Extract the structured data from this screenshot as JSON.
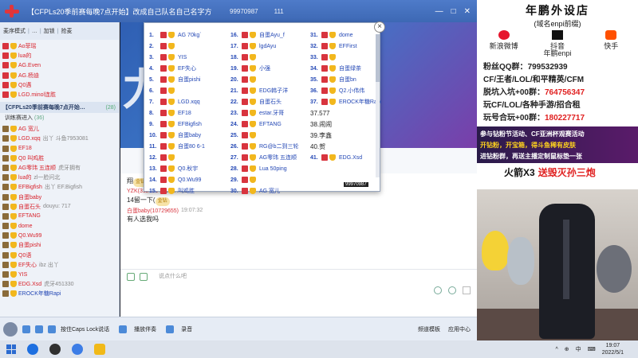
{
  "titlebar": {
    "title": "【CFPLs20季前赛每晚7点开始】改成自己队名自己名字方便…",
    "room_id": "99970987",
    "count": "111",
    "controls": [
      "—",
      "□",
      "✕"
    ]
  },
  "sidebar": {
    "tabs": [
      "麦序模式",
      "…",
      "加锁",
      "抢麦"
    ],
    "mic_list": [
      {
        "mark": "u",
        "name": "Ao菲瑶",
        "c": "red"
      },
      {
        "mark": "u",
        "name": "lua的",
        "c": "red"
      },
      {
        "mark": "u",
        "name": "AG.Even",
        "c": "red"
      },
      {
        "mark": "u",
        "name": "AG.杨迪",
        "c": "red"
      },
      {
        "mark": "u",
        "name": "Q0遇",
        "c": "red"
      },
      {
        "mark": "u",
        "name": "LGD.minol连胜",
        "c": "red"
      }
    ],
    "channel": {
      "name": "【CFPLs20季前赛每晚7点开始…",
      "count": "(28)"
    },
    "sub_channel": {
      "name": "训练赛进入",
      "count": "(36)"
    },
    "users": [
      {
        "name": "AG 宽儿",
        "c": "red",
        "extra": ""
      },
      {
        "name": "LGD.xqq",
        "c": "red",
        "extra": "出丫 斗鱼7953081"
      },
      {
        "name": "EF18",
        "c": "red",
        "extra": ""
      },
      {
        "name": "Q0 叫鸡胜",
        "c": "red",
        "extra": ""
      },
      {
        "name": "AG零玮 五连顺",
        "c": "red",
        "extra": "虎牙拥有"
      },
      {
        "name": "lua的",
        "c": "red",
        "extra": "zl一脸问北"
      },
      {
        "name": "EFBigfish",
        "c": "red",
        "extra": "出丫 EF.Bigfish"
      },
      {
        "name": "自蛋baby",
        "c": "red",
        "extra": ""
      },
      {
        "name": "自蛋石头",
        "c": "red",
        "extra": "douyu: 717"
      },
      {
        "name": "EFTANG",
        "c": "red",
        "extra": ""
      },
      {
        "name": "dome",
        "c": "red",
        "extra": ""
      },
      {
        "name": "Q0.Wu99",
        "c": "red",
        "extra": ""
      },
      {
        "name": "自蛋pishi",
        "c": "red",
        "extra": ""
      },
      {
        "name": "Q0语",
        "c": "red",
        "extra": ""
      },
      {
        "name": "EF失心",
        "c": "red",
        "extra": "ibz 出丫"
      },
      {
        "name": "YIS",
        "c": "red",
        "extra": ""
      },
      {
        "name": "EDG.Xsd",
        "c": "red",
        "extra": "虎牙451330"
      },
      {
        "name": "EROCK年糖Rapi",
        "c": "blue",
        "extra": ""
      }
    ]
  },
  "main": {
    "banner_text": "力",
    "chat": [
      {
        "meta": "",
        "who": "",
        "time": "",
        "body": "翔",
        "badge": "金钻"
      },
      {
        "meta": "YZK(3127864)",
        "who": "",
        "time": "19:07:31",
        "body": "14留一下(",
        "badge": "金钻"
      },
      {
        "meta": "白蛋baby(10729655)",
        "who": "",
        "time": "19:07:32",
        "body": "有人选我吗",
        "badge": ""
      }
    ],
    "input_placeholder": "说点什么吧"
  },
  "appbar": {
    "items": [
      "按住Caps Lock说话",
      "播放伴奏",
      "录音"
    ],
    "right": [
      "频道模板",
      "应用中心"
    ]
  },
  "popup": {
    "col1": [
      {
        "n": "1.",
        "name": "AG 70kg`"
      },
      {
        "n": "2.",
        "name": ""
      },
      {
        "n": "3.",
        "name": "YIS"
      },
      {
        "n": "4.",
        "name": "EF失心"
      },
      {
        "n": "5.",
        "name": "自蛋pishi"
      },
      {
        "n": "6.",
        "name": ""
      },
      {
        "n": "7.",
        "name": "LGD.xqq"
      },
      {
        "n": "8.",
        "name": "EF18"
      },
      {
        "n": "9.",
        "name": "EFBigfish"
      },
      {
        "n": "10.",
        "name": "自蛋baby"
      },
      {
        "n": "11.",
        "name": "自蛋80 6-1"
      },
      {
        "n": "12.",
        "name": ""
      },
      {
        "n": "13.",
        "name": "Q0.秋宇"
      },
      {
        "n": "14.",
        "name": "Q0.Wu99"
      },
      {
        "n": "15.",
        "name": "叫鸡胜"
      }
    ],
    "col2": [
      {
        "n": "16.",
        "name": "自蛋Ayu_f"
      },
      {
        "n": "17.",
        "name": "lgdAyu"
      },
      {
        "n": "18.",
        "name": ""
      },
      {
        "n": "19.",
        "name": "小强"
      },
      {
        "n": "20.",
        "name": ""
      },
      {
        "n": "21.",
        "name": "EDG韩子洋"
      },
      {
        "n": "22.",
        "name": "自蛋石头"
      },
      {
        "n": "23.",
        "name": "estar.牙哥"
      },
      {
        "n": "24.",
        "name": "EFTANG"
      },
      {
        "n": "25.",
        "name": ""
      },
      {
        "n": "26.",
        "name": "RG@b二到三轮"
      },
      {
        "n": "27.",
        "name": "AG零玮 五连顺"
      },
      {
        "n": "28.",
        "name": "Lua 50ping"
      },
      {
        "n": "29.",
        "name": ""
      },
      {
        "n": "30.",
        "name": "AG 宽儿"
      }
    ],
    "col3": [
      {
        "n": "31.",
        "name": "dome"
      },
      {
        "n": "32.",
        "name": "EFFirst"
      },
      {
        "n": "33.",
        "name": ""
      },
      {
        "n": "34.",
        "name": "自蛋绿茶"
      },
      {
        "n": "35.",
        "name": "自蛋bn"
      },
      {
        "n": "36.",
        "name": "Q2.小伟伟"
      },
      {
        "n": "37.",
        "name": "EROCK年糖Rapi"
      }
    ],
    "plain": [
      {
        "n": "37.",
        "name": "577"
      },
      {
        "n": "38.",
        "name": "闹闹"
      },
      {
        "n": "39.",
        "name": "李鑫"
      },
      {
        "n": "40.",
        "name": "贺"
      }
    ],
    "last": {
      "n": "41.",
      "name": "EDG.Xsd"
    },
    "footer": "99970987"
  },
  "stream": {
    "title": "年鹏外设店",
    "subtitle": "(域名enpi前缀)",
    "socials": [
      "新浪微博",
      "抖音",
      "快手"
    ],
    "logo": "年鹏enpi",
    "info": [
      {
        "label": "粉丝QQ群：",
        "value": "799532939",
        "red": false
      },
      {
        "label": "CF/王者/LOL/和平精英/CFM",
        "value": "",
        "red": false
      },
      {
        "label": "脱坑入坑+00群：",
        "value": "764756347",
        "red": true
      },
      {
        "label": "玩CF/LOL/各种手游/招合租",
        "value": "",
        "red": false
      },
      {
        "label": "玩号合玩+00群：",
        "value": "180227717",
        "red": true
      }
    ],
    "event": [
      "参与钻粉节活动、CF亚洲杯观赛活动",
      "开钻粉，开宝箱，得斗鱼稀有皮肤",
      "进钻粉群，再送主播定制鼠标垫一张"
    ],
    "rocket": {
      "left": "火箭X3",
      "right": "送毁灭孙三炮"
    }
  },
  "taskbar": {
    "time": "19:07",
    "date": "2022/5/1",
    "sys": [
      "^",
      "⊕",
      "中",
      "⌨"
    ]
  }
}
